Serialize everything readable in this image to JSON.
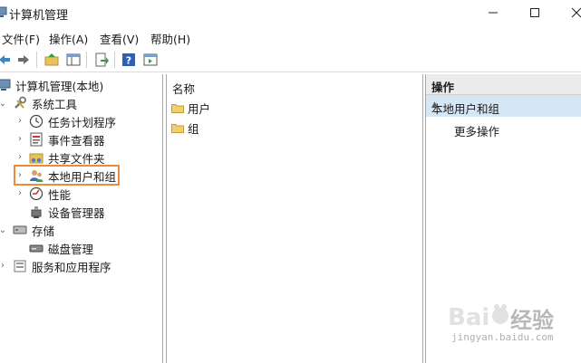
{
  "window": {
    "title": "计算机管理"
  },
  "menubar": {
    "file": "文件(F)",
    "action": "操作(A)",
    "view": "查看(V)",
    "help": "帮助(H)"
  },
  "toolbar": {
    "icons": [
      "back-arrow-icon",
      "forward-arrow-icon",
      "up-folder-icon",
      "show-hide-tree-icon",
      "export-list-icon",
      "help-icon",
      "show-action-pane-icon"
    ]
  },
  "tree": {
    "root": "计算机管理(本地)",
    "system_tools": "系统工具",
    "task_scheduler": "任务计划程序",
    "event_viewer": "事件查看器",
    "shared_folders": "共享文件夹",
    "local_users_groups": "本地用户和组",
    "performance": "性能",
    "device_manager": "设备管理器",
    "storage": "存储",
    "disk_management": "磁盘管理",
    "services_apps": "服务和应用程序"
  },
  "list": {
    "column_name": "名称",
    "items": [
      "用户",
      "组"
    ]
  },
  "actions": {
    "header": "操作",
    "group": "本地用户和组",
    "more": "更多操作"
  },
  "watermark": {
    "text": "Bai 经验",
    "url": "jingyan.baidu.com"
  },
  "colors": {
    "highlight_border": "#ef8a3c",
    "selected_action_bg": "#d5e6f5",
    "folder": "#e8c25a"
  }
}
